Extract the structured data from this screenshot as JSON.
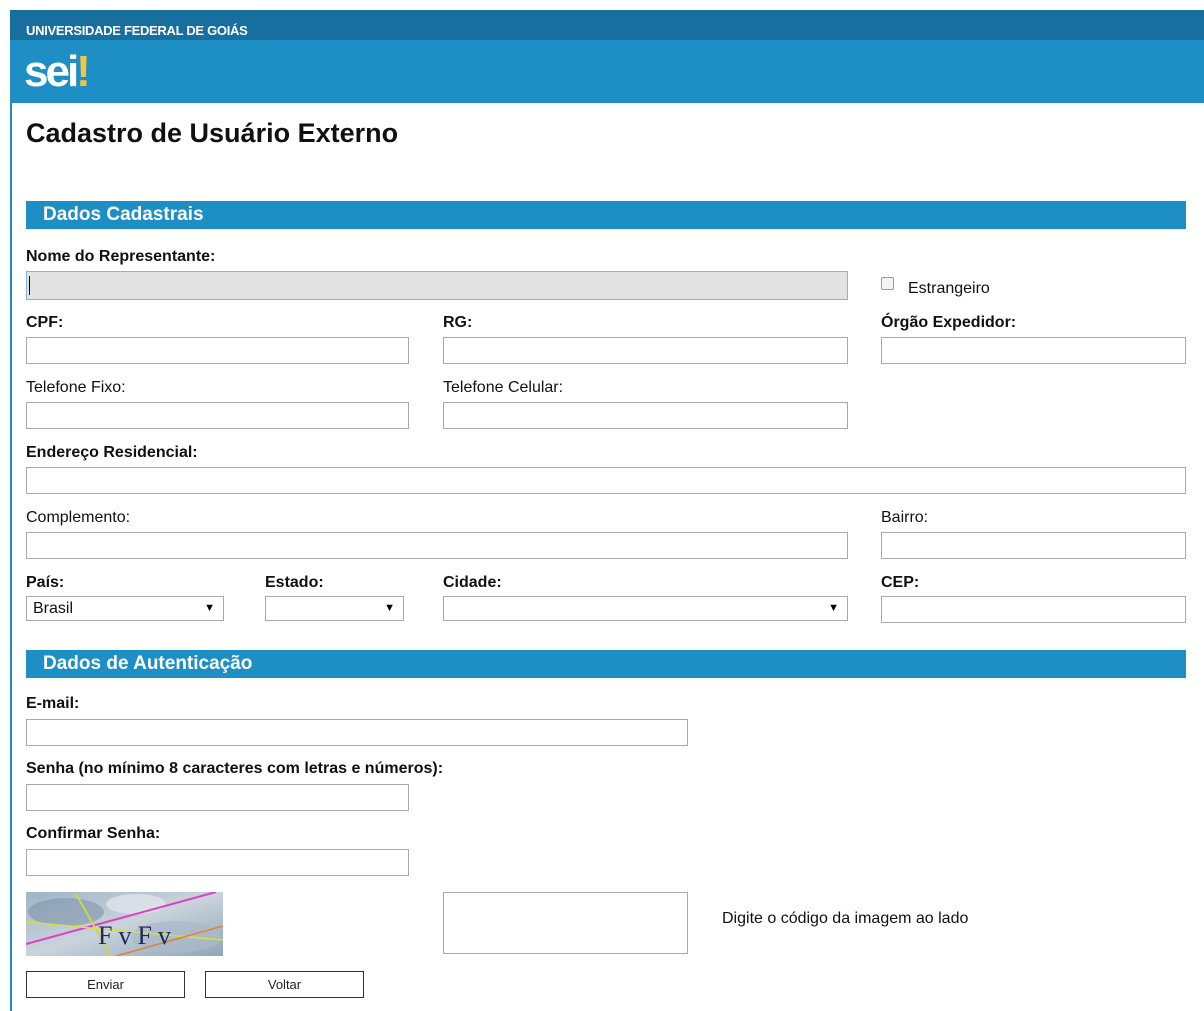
{
  "header": {
    "institution": "UNIVERSIDADE FEDERAL DE GOIÁS",
    "logo_text": "sei",
    "logo_mark": "!",
    "brand_color": "#1e8fc4",
    "brand_dark": "#176fa0"
  },
  "page": {
    "title": "Cadastro de Usuário Externo"
  },
  "sections": {
    "dados_cadastrais": "Dados Cadastrais",
    "dados_autenticacao": "Dados de Autenticação"
  },
  "form": {
    "nome_label": "Nome do Representante:",
    "nome_value": "",
    "estrangeiro_label": "Estrangeiro",
    "estrangeiro_checked": false,
    "cpf_label": "CPF:",
    "rg_label": "RG:",
    "orgao_label": "Órgão Expedidor:",
    "tel_fixo_label": "Telefone Fixo:",
    "tel_celular_label": "Telefone Celular:",
    "endereco_label": "Endereço Residencial:",
    "complemento_label": "Complemento:",
    "bairro_label": "Bairro:",
    "pais_label": "País:",
    "pais_value": "Brasil",
    "estado_label": "Estado:",
    "estado_value": "",
    "cidade_label": "Cidade:",
    "cidade_value": "",
    "cep_label": "CEP:",
    "email_label": "E-mail:",
    "senha_label": "Senha (no mínimo 8 caracteres com letras e números):",
    "confirmar_label": "Confirmar Senha:",
    "captcha_text": "FvFv",
    "captcha_hint": "Digite o código da imagem ao lado"
  },
  "buttons": {
    "enviar": "Enviar",
    "voltar": "Voltar"
  }
}
